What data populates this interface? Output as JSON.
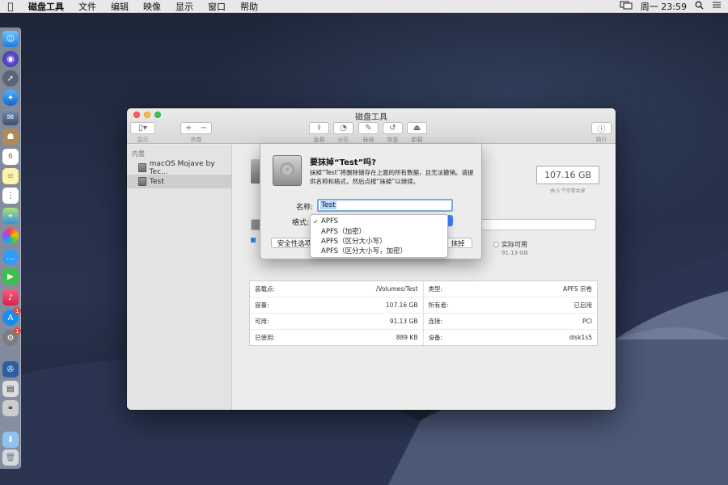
{
  "menubar": {
    "app_name": "磁盘工具",
    "items": [
      "文件",
      "编辑",
      "映像",
      "显示",
      "窗口",
      "帮助"
    ],
    "clock": "周一 23:59"
  },
  "window": {
    "title": "磁盘工具",
    "toolbar": {
      "view_label": "显示",
      "volume_label": "宗卷",
      "firstaid_label": "急救",
      "partition_label": "分区",
      "erase_label": "抹掉",
      "restore_label": "恢复",
      "unmount_label": "卸载",
      "info_label": "简介",
      "add_symbol": "+",
      "remove_symbol": "−",
      "info_symbol": "ⓘ"
    },
    "sidebar": {
      "section": "内置",
      "items": [
        {
          "label": "macOS Mojave by Tec..."
        },
        {
          "label": "Test"
        }
      ]
    },
    "capacity": {
      "value": "107.16 GB",
      "note": "由 5 个宗卷共享"
    },
    "usage": {
      "used_fraction": 0.008,
      "available_label": "实际可用",
      "available_value": "91.13 GB"
    },
    "info": {
      "left": [
        {
          "k": "装载点:",
          "v": "/Volumes/Test"
        },
        {
          "k": "容量:",
          "v": "107.16 GB"
        },
        {
          "k": "可用:",
          "v": "91.13 GB"
        },
        {
          "k": "已使用:",
          "v": "889 KB"
        }
      ],
      "right": [
        {
          "k": "类型:",
          "v": "APFS 宗卷"
        },
        {
          "k": "所有者:",
          "v": "已启用"
        },
        {
          "k": "连接:",
          "v": "PCI"
        },
        {
          "k": "设备:",
          "v": "disk1s5"
        }
      ]
    }
  },
  "sheet": {
    "title": "要抹掉“Test”吗?",
    "message": "抹掉“Test”将删除储存在上面的所有数据，且无法撤销。请提供名称和格式，然后点按“抹掉”以继续。",
    "name_label": "名称:",
    "name_value": "Test",
    "format_label": "格式:",
    "security_button": "安全性选项",
    "erase_button": "抹掉",
    "format_options": [
      {
        "label": "APFS",
        "checked": true
      },
      {
        "label": "APFS（加密）",
        "checked": false
      },
      {
        "label": "APFS（区分大小写）",
        "checked": false
      },
      {
        "label": "APFS（区分大小写，加密）",
        "checked": false
      }
    ]
  },
  "colors": {
    "accent": "#3b82f6",
    "red": "#fc605c",
    "yellow": "#fdbc40",
    "green": "#34c84a"
  }
}
